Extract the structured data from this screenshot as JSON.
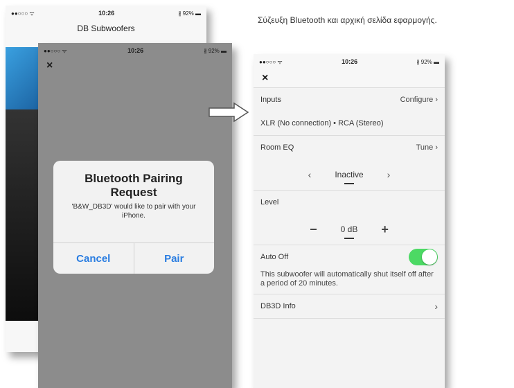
{
  "caption": "Σύζευξη Bluetooth και αρχική σελίδα εφαρμογής.",
  "status": {
    "signal": "●●○○○ ᯤ",
    "time": "10:26",
    "battery": "∦ 92% ▬"
  },
  "bg_screen": {
    "title": "DB Subwoofers"
  },
  "dialog_screen": {
    "close_label": "×",
    "alert": {
      "title": "Bluetooth Pairing Request",
      "message": "'B&W_DB3D' would like to pair with your iPhone.",
      "cancel_label": "Cancel",
      "pair_label": "Pair"
    }
  },
  "app": {
    "close_label": "×",
    "inputs": {
      "label": "Inputs",
      "action": "Configure ›",
      "value": "XLR (No connection) • RCA (Stereo)"
    },
    "room_eq": {
      "label": "Room EQ",
      "action": "Tune ›",
      "prev": "‹",
      "value": "Inactive",
      "next": "›"
    },
    "level": {
      "label": "Level",
      "minus": "−",
      "value": "0 dB",
      "plus": "+"
    },
    "auto_off": {
      "label": "Auto Off",
      "enabled": true,
      "description": "This subwoofer will automatically shut itself off after a period of 20 minutes."
    },
    "info": {
      "label": "DB3D Info",
      "chevron": "›"
    }
  },
  "colors": {
    "toggle_on": "#4cd964",
    "ios_blue": "#2a7de1",
    "dim_overlay": "#8c8c8c"
  }
}
